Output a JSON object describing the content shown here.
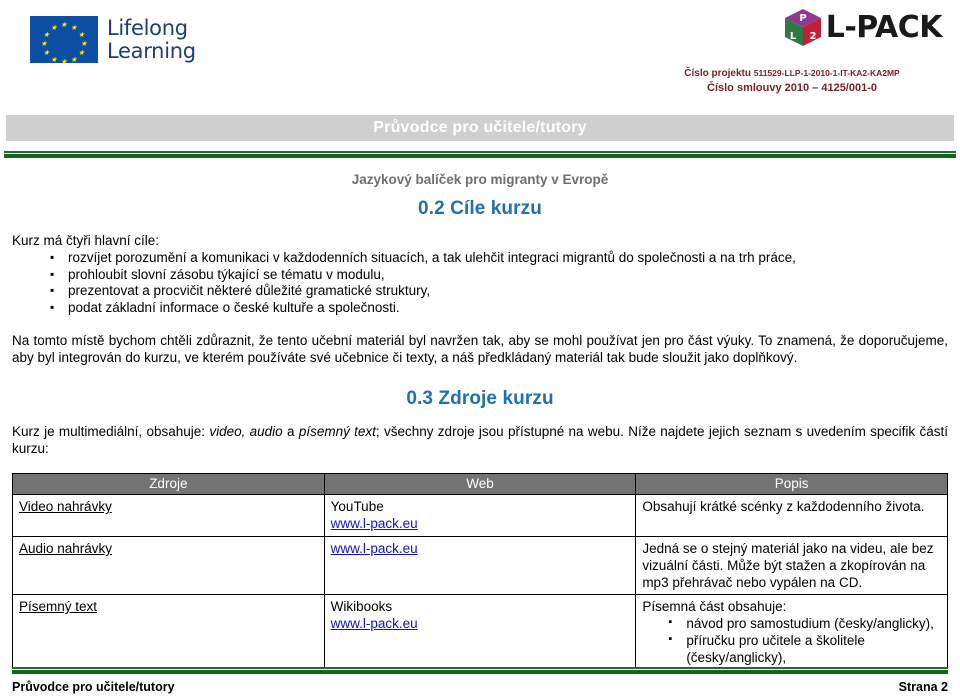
{
  "header": {
    "eu_logo_line1": "Lifelong",
    "eu_logo_line2": "Learning",
    "lpack_wordmark": "L-PACK",
    "cube_faces": {
      "top": "P",
      "left": "L",
      "right": "2"
    },
    "project_number_label": "Číslo projektu",
    "project_number_value": "511529-LLP-1-2010-1-IT-KA2-KA2MP",
    "contract_number": "Číslo smlouvy 2010 – 4125/001-0",
    "project_text_color": "#7b1f22"
  },
  "title_band": {
    "title": "Průvodce pro učitele/tutory",
    "background": "#cfcfcf",
    "text_color": "#ffffff"
  },
  "rule_color": "#14641f",
  "subtitle": "Jazykový balíček pro migranty v Evropě",
  "sections": [
    {
      "heading": "0.2 Cíle kurzu",
      "heading_color": "#1f6fb5",
      "lead": "Kurz má čtyři hlavní cíle:",
      "goals": [
        "rozvíjet porozumění a komunikaci v každodenních situacích,  a tak ulehčit integraci migrantů do společnosti a na trh práce,",
        "prohloubit slovní zásobu týkající se tématu v modulu,",
        "prezentovat a procvičit některé důležité gramatické struktury,",
        "podat základní informace o české kultuře a společnosti."
      ],
      "paragraph": "Na tomto místě bychom chtěli zdůraznit, že tento učební materiál byl navržen tak, aby se mohl používat jen pro část výuky. To znamená, že doporučujeme, aby byl integrován do kurzu, ve kterém používáte své učebnice či texty, a náš předkládaný materiál tak bude sloužit jako doplňkový."
    },
    {
      "heading": "0.3 Zdroje kurzu",
      "heading_color": "#1f6fb5",
      "paragraph_parts": {
        "p1": "Kurz je multimediální, obsahuje: ",
        "i1": "video, audio",
        "p2": " a ",
        "i2": "písemný text",
        "p3": "; všechny zdroje jsou přístupné na webu. Níže najdete jejich seznam s uvedením specifik částí kurzu:"
      }
    }
  ],
  "table": {
    "headers": [
      "Zdroje",
      "Web",
      "Popis"
    ],
    "header_bg": "#737373",
    "link_color": "#1010cf",
    "rows": [
      {
        "source": "Video nahrávky",
        "web_platform": "YouTube",
        "web_link": "www.l-pack.eu",
        "description": "Obsahují krátké scénky z každodenního života.",
        "bullets": []
      },
      {
        "source": "Audio nahrávky",
        "web_platform": "",
        "web_link": "www.l-pack.eu",
        "description": "Jedná se o stejný materiál jako na videu, ale bez vizuální části. Může být stažen a zkopírován na mp3 přehrávač nebo vypálen na CD.",
        "bullets": []
      },
      {
        "source": "Písemný text",
        "web_platform": "Wikibooks",
        "web_link": "www.l-pack.eu",
        "description": "Písemná část obsahuje:",
        "bullets": [
          "návod pro samostudium (česky/anglicky),",
          "příručku pro učitele a školitele (česky/anglicky),"
        ]
      }
    ]
  },
  "footer": {
    "left": "Průvodce pro učitele/tutory",
    "right": "Strana 2"
  }
}
